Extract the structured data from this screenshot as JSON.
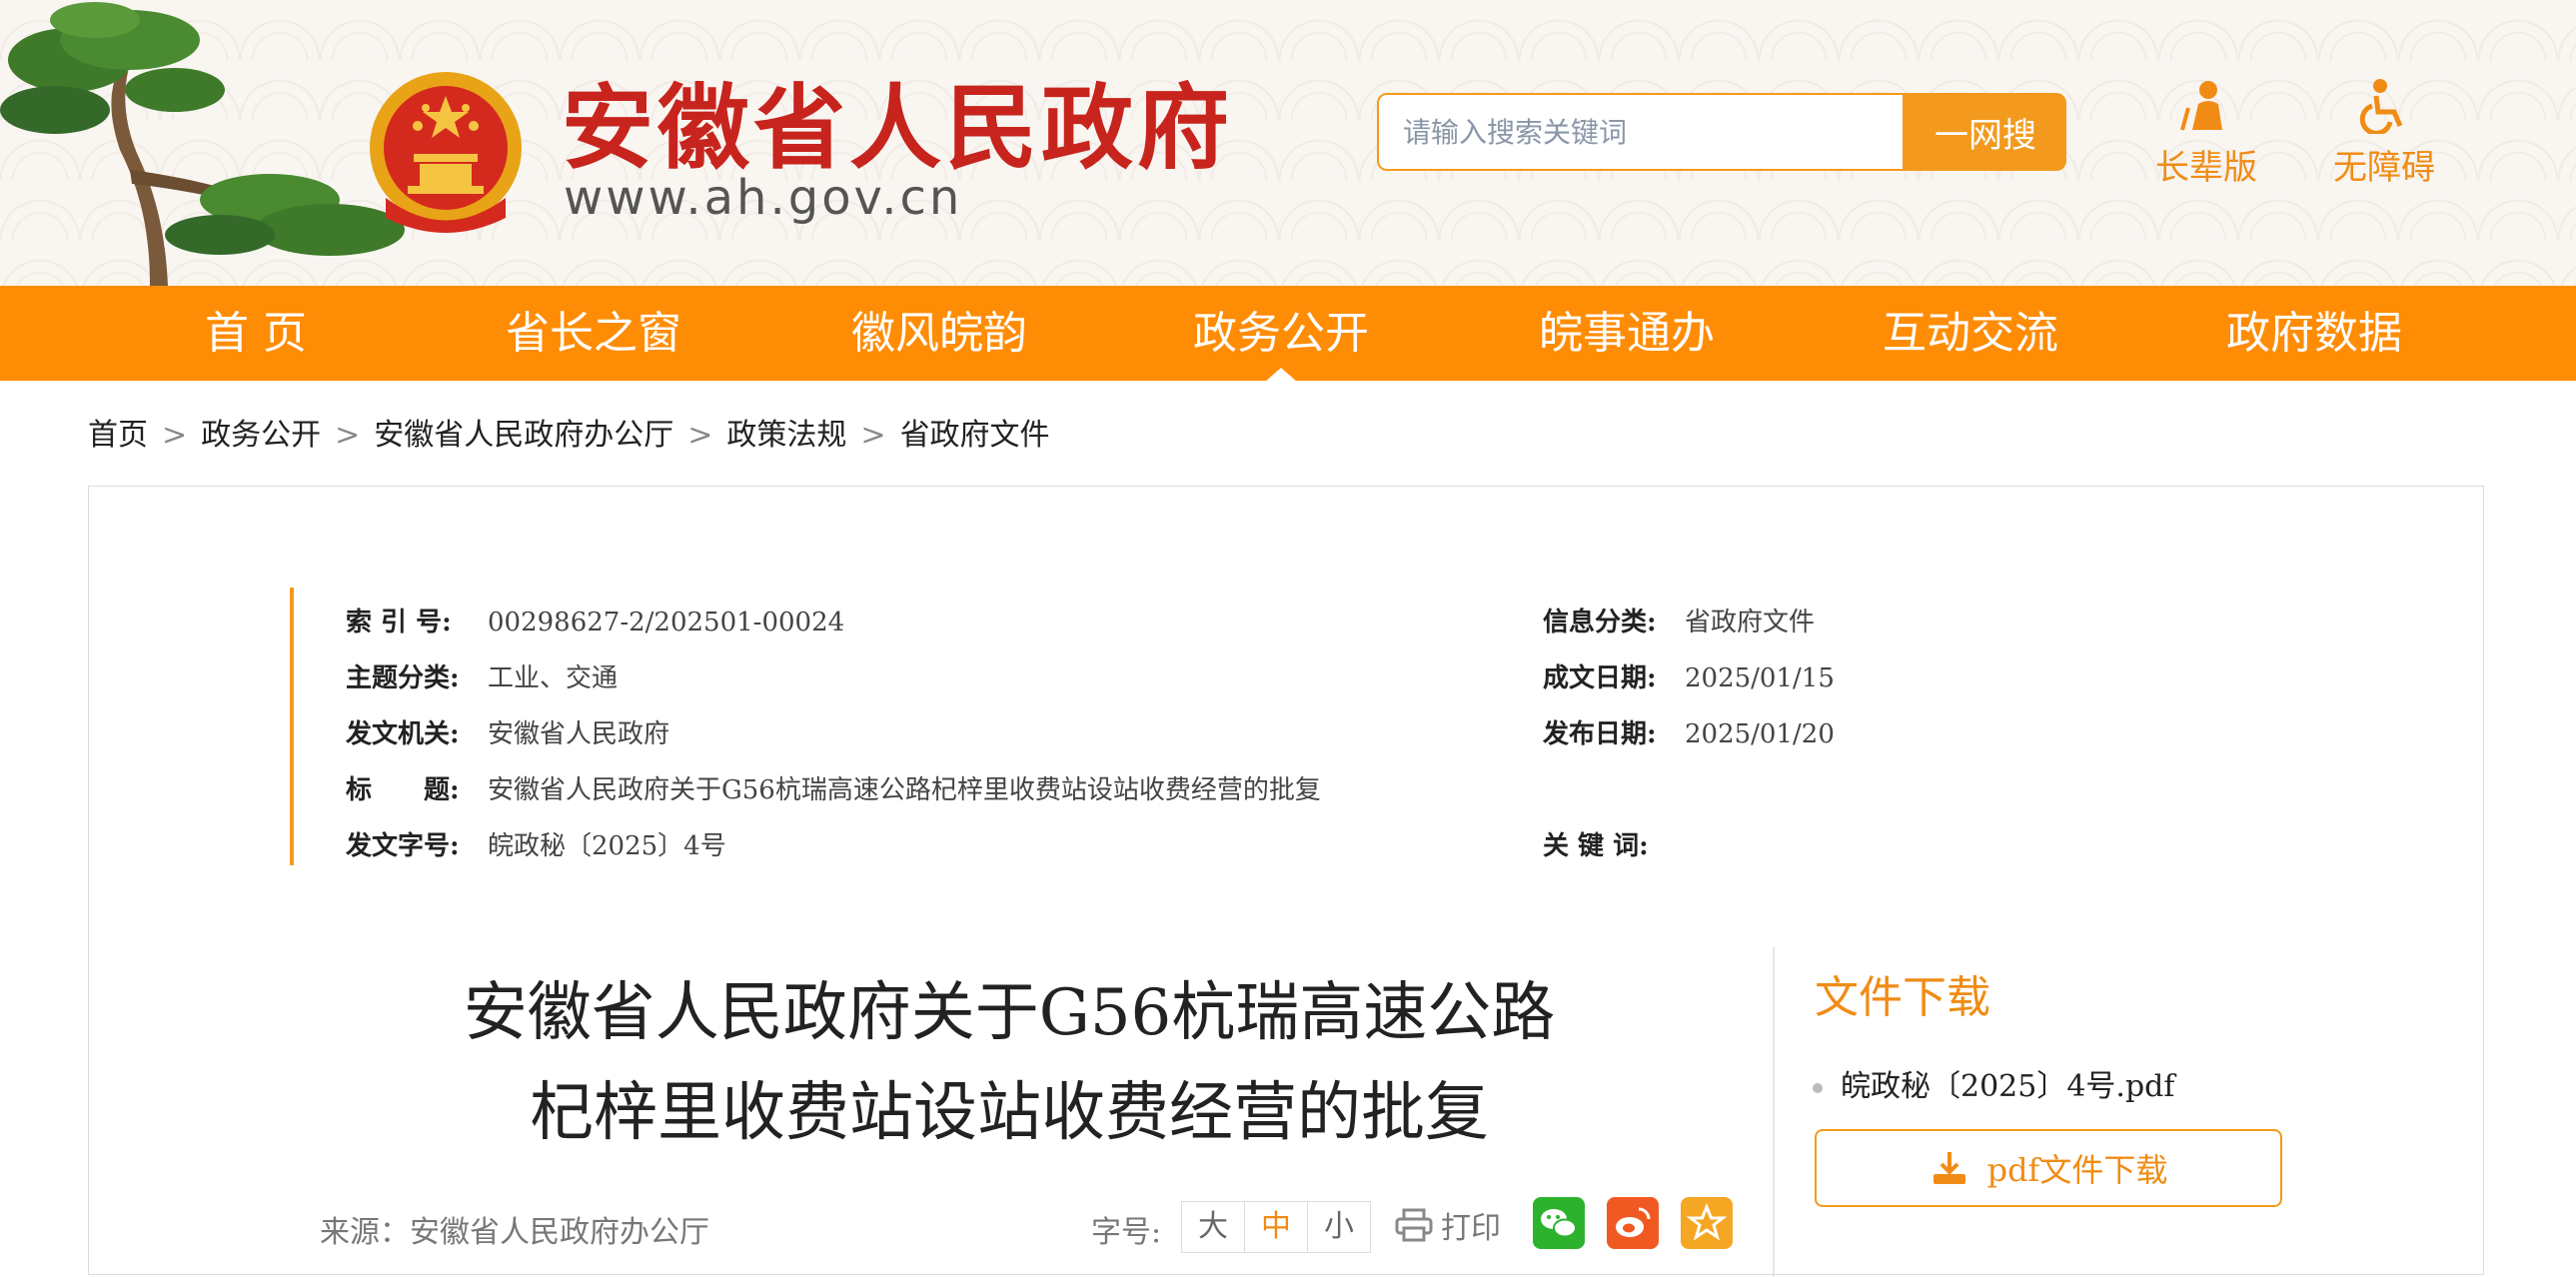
{
  "header": {
    "site_name": "安徽省人民政府",
    "site_url": "www.ah.gov.cn",
    "search_placeholder": "请输入搜索关键词",
    "search_button": "一网搜",
    "tools": [
      {
        "label": "长辈版",
        "icon": "elder-icon"
      },
      {
        "label": "无障碍",
        "icon": "wheelchair-icon"
      }
    ]
  },
  "nav": {
    "items": [
      "首 页",
      "省长之窗",
      "徽风皖韵",
      "政务公开",
      "皖事通办",
      "互动交流",
      "政府数据"
    ],
    "active": "政务公开"
  },
  "breadcrumb": [
    "首页",
    "政务公开",
    "安徽省人民政府办公厅",
    "政策法规",
    "省政府文件"
  ],
  "breadcrumb_separator": ">",
  "meta": {
    "index_no": {
      "label": "索 引 号:",
      "value": "00298627-2/202501-00024"
    },
    "category": {
      "label": "信息分类:",
      "value": "省政府文件"
    },
    "topic": {
      "label": "主题分类:",
      "value": "工业、交通"
    },
    "written_date": {
      "label": "成文日期:",
      "value": "2025/01/15"
    },
    "issuer": {
      "label": "发文机关:",
      "value": "安徽省人民政府"
    },
    "publish_date": {
      "label": "发布日期:",
      "value": "2025/01/20"
    },
    "title": {
      "label": "标　　题:",
      "value": "安徽省人民政府关于G56杭瑞高速公路杞梓里收费站设站收费经营的批复"
    },
    "doc_no": {
      "label": "发文字号:",
      "value": "皖政秘〔2025〕4号"
    },
    "keywords": {
      "label": "关 键 词:",
      "value": ""
    }
  },
  "article": {
    "title_line1": "安徽省人民政府关于G56杭瑞高速公路",
    "title_line2": "杞梓里收费站设站收费经营的批复",
    "source": "来源：安徽省人民政府办公厅",
    "font_size_label": "字号:",
    "font_sizes": [
      "大",
      "中",
      "小"
    ],
    "font_size_selected": "中",
    "print_label": "打印",
    "share_icons": [
      "wechat-icon",
      "weibo-icon",
      "favorite-icon"
    ]
  },
  "download": {
    "title": "文件下载",
    "file_name": "皖政秘〔2025〕4号.pdf",
    "button_label": "pdf文件下载"
  },
  "colors": {
    "accent": "#ff8c05",
    "brand_red": "#c7241d",
    "wechat": "#2db22e",
    "weibo": "#f05a22",
    "favorite": "#f5a623"
  }
}
